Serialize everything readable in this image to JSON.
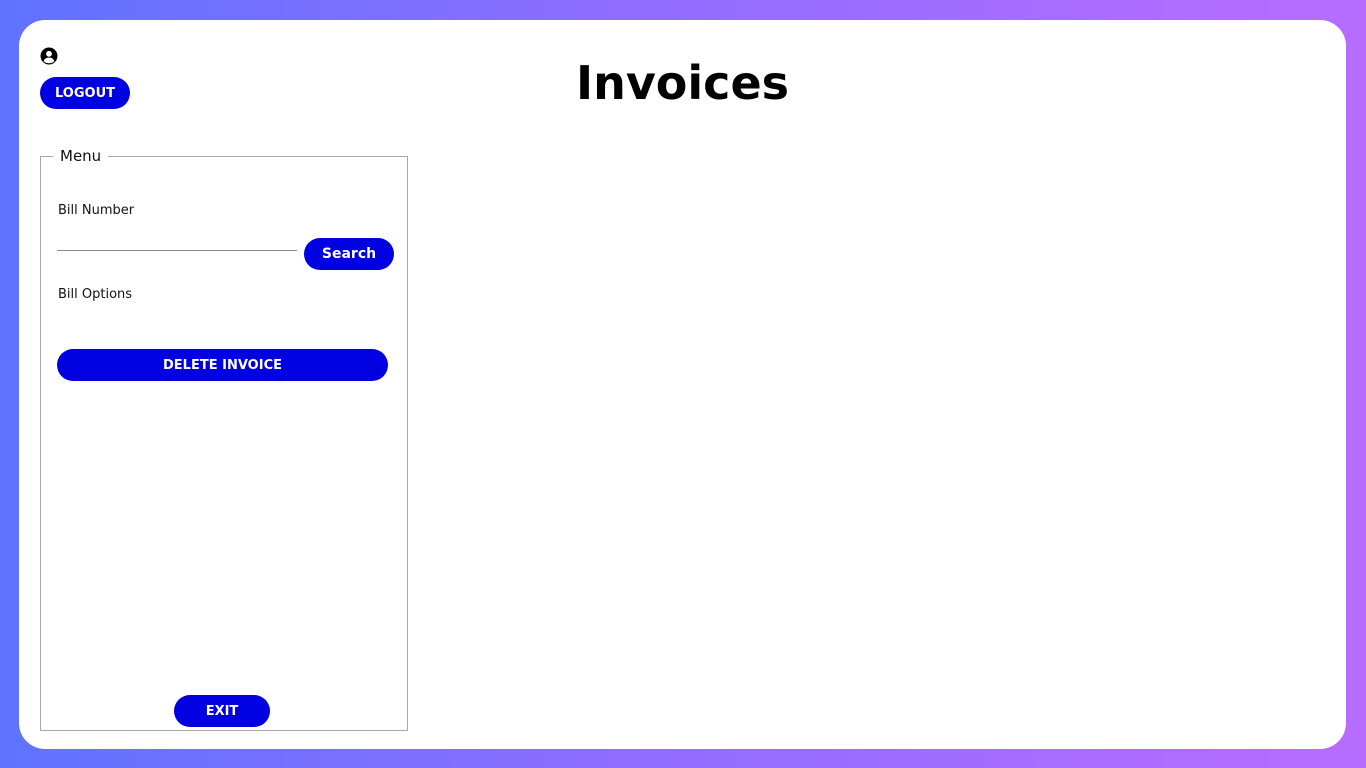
{
  "header": {
    "title": "Invoices",
    "logout_label": "LOGOUT",
    "user_icon": "user-circle-icon"
  },
  "menu": {
    "legend": "Menu",
    "bill_number_label": "Bill Number",
    "bill_number_value": "",
    "search_label": "Search",
    "bill_options_label": "Bill Options",
    "delete_label": "DELETE INVOICE",
    "exit_label": "EXIT"
  },
  "colors": {
    "accent": "#0000e0",
    "background_gradient_start": "#5f73ff",
    "background_gradient_end": "#b86dff"
  }
}
